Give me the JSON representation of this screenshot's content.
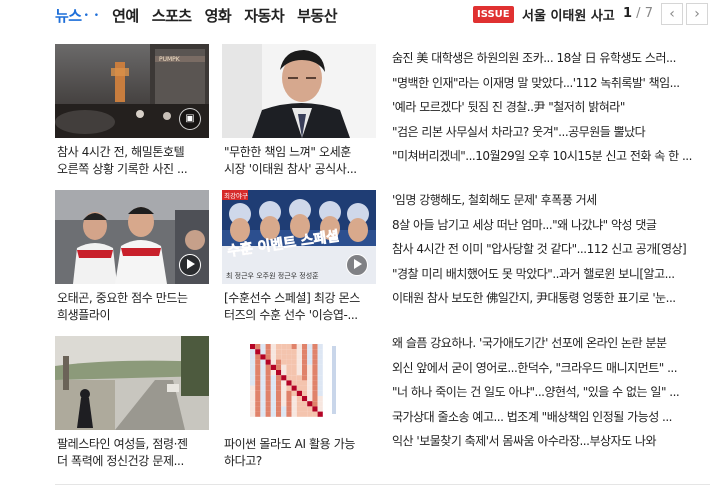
{
  "nav": {
    "tabs": [
      "뉴스",
      "연예",
      "스포츠",
      "영화",
      "자동차",
      "부동산"
    ],
    "dots": "• •"
  },
  "issue": {
    "badge": "ISSUE",
    "text": "서울 이태원 사고",
    "page_current": "1",
    "page_sep": " / ",
    "page_total": "7",
    "prev": "‹",
    "next": "›"
  },
  "cards": [
    {
      "line1": "참사 4시간 전, 해밀톤호텔",
      "line2": "오른쪽 상황 기록한 사진 ..."
    },
    {
      "line1": "\"무한한 책임 느껴\" 오세훈",
      "line2": "시장 '이태원 참사' 공식사..."
    },
    {
      "line1": "오태곤, 중요한 점수 만드는",
      "line2": "희생플라이"
    },
    {
      "line1": "[수훈선수 스페셜] 최강 몬스",
      "line2": "터즈의 수훈 선수 '이승엽-..."
    },
    {
      "line1": "팔레스타인 여성들, 점령·젠",
      "line2": "더 폭력에 정신건강 문제..."
    },
    {
      "line1": "파이썬 몰라도 AI 활용 가능",
      "line2": "하다고?"
    }
  ],
  "headlines": [
    "숨진 美 대학생은 하원의원 조카... 18살 日 유학생도 스러...",
    "\"명백한 인재\"라는 이재명 말 맞았다...'112 녹취록발' 책임...",
    "'예라 모르겠다' 뒷짐 진 경찰..尹 \"철저히 밝혀라\"",
    "\"검은 리본 사무실서 차라고? 웃겨\"...공무원들 뿔났다",
    "\"미쳐버리겠네\"...10월29일 오후 10시15분 신고 전화 속 한 ...",
    "'임명 강행해도, 철회해도 문제' 후폭풍 거세",
    "8살 아들 남기고 세상 떠난 엄마...\"왜 나갔냐\" 악성 댓글",
    "참사 4시간 전 이미 \"압사당할 것 같다\"...112 신고 공개[영상]",
    "\"경찰 미리 배치했어도 못 막았다\"..과거 핼로윈 보니[알고...",
    "이태원 참사 보도한 佛일간지, 尹대통령 엉뚱한 표기로 '눈...",
    "왜 슬픔 강요하나. '국가애도기간' 선포에 온라인 논란 분분",
    "외신 앞에서 굳이 영어로...한덕수, \"크라우드 매니지먼트\" ...",
    "\"너 하나 죽이는 건 일도 아냐\"...양현석, \"있을 수 없는 일\" ...",
    "국가상대 줄소송 예고... 법조계 \"배상책임 인정될 가능성 ...",
    "익산 '보물찾기 축제'서 몸싸움 아수라장...부상자도 나와"
  ],
  "thumb_labels": {
    "hotel_sign": "PUMPK",
    "baseball_text": "수훈 이벤트 스페셜",
    "baseball_badge": "최강야구",
    "baseball_names": "최   정근우 오주원 정근우 정성훈"
  },
  "colors": {
    "accent": "#1e6fd9",
    "issue_red": "#e03131"
  }
}
